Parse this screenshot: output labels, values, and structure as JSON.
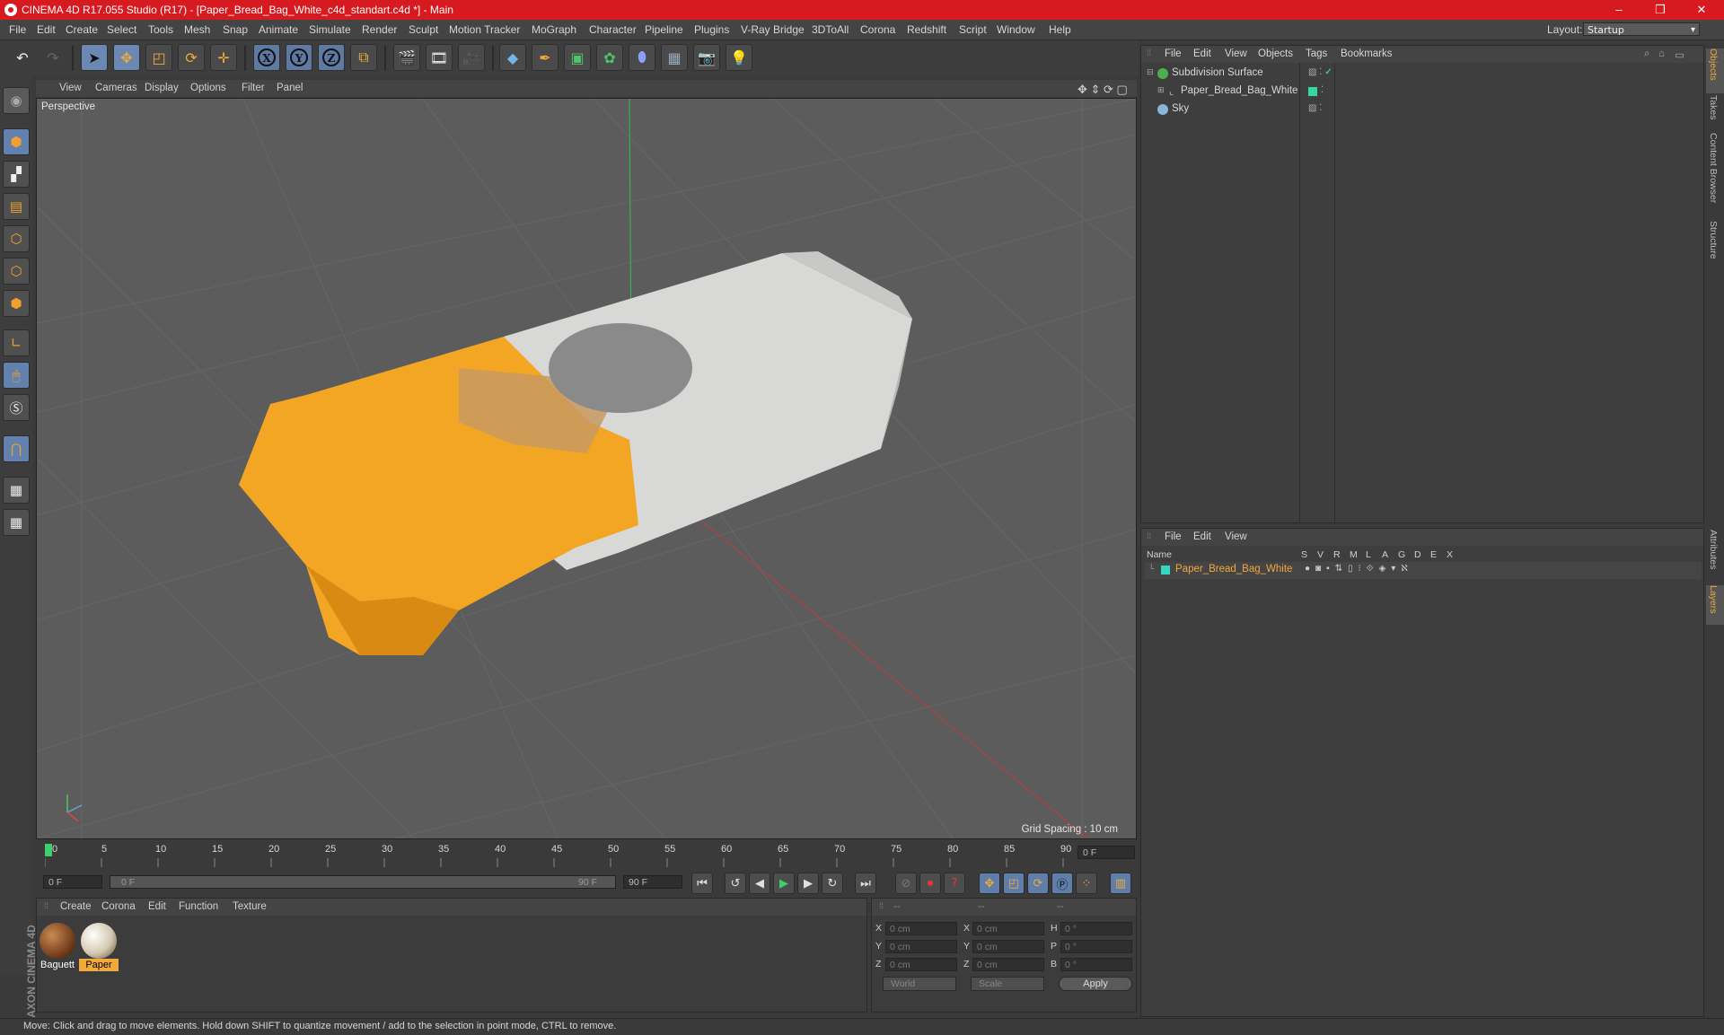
{
  "window": {
    "title": "CINEMA 4D R17.055 Studio (R17) - [Paper_Bread_Bag_White_c4d_standart.c4d *] - Main",
    "minimize": "–",
    "maximize": "❐",
    "close": "✕"
  },
  "menubar": {
    "items": [
      "File",
      "Edit",
      "Create",
      "Select",
      "Tools",
      "Mesh",
      "Snap",
      "Animate",
      "Simulate",
      "Render",
      "Sculpt",
      "Motion Tracker",
      "MoGraph",
      "Character",
      "Pipeline",
      "Plugins",
      "V-Ray Bridge",
      "3DToAll",
      "Corona",
      "Redshift",
      "Script",
      "Window",
      "Help"
    ],
    "layout_label": "Layout:",
    "layout_value": "Startup"
  },
  "toolbar": {
    "axis_x": "X",
    "axis_y": "Y",
    "axis_z": "Z"
  },
  "viewport": {
    "menu": [
      "View",
      "Cameras",
      "Display",
      "Options",
      "Filter",
      "Panel"
    ],
    "camera_label": "Perspective",
    "grid_spacing": "Grid Spacing : 10 cm"
  },
  "timeline": {
    "ticks": [
      "0",
      "5",
      "10",
      "15",
      "20",
      "25",
      "30",
      "35",
      "40",
      "45",
      "50",
      "55",
      "60",
      "65",
      "70",
      "75",
      "80",
      "85",
      "90"
    ],
    "current_frame": "0 F",
    "start_frame": "0 F",
    "range_start": "0 F",
    "range_end": "90 F",
    "end_frame": "90 F"
  },
  "materials": {
    "menu": [
      "Create",
      "Corona",
      "Edit",
      "Function",
      "Texture"
    ],
    "items": [
      {
        "name": "Baguett",
        "selected": false
      },
      {
        "name": "Paper",
        "selected": true
      }
    ]
  },
  "coordinates": {
    "header": [
      "--",
      "--",
      "--"
    ],
    "rows": [
      {
        "a": "X",
        "v1": "0 cm",
        "b": "X",
        "v2": "0 cm",
        "c": "H",
        "v3": "0 °"
      },
      {
        "a": "Y",
        "v1": "0 cm",
        "b": "Y",
        "v2": "0 cm",
        "c": "P",
        "v3": "0 °"
      },
      {
        "a": "Z",
        "v1": "0 cm",
        "b": "Z",
        "v2": "0 cm",
        "c": "B",
        "v3": "0 °"
      }
    ],
    "space": "World",
    "mode": "Scale",
    "apply": "Apply"
  },
  "objects": {
    "menu": [
      "File",
      "Edit",
      "View",
      "Objects",
      "Tags",
      "Bookmarks"
    ],
    "items": [
      {
        "name": "Subdivision Surface",
        "color": "#4caf50"
      },
      {
        "name": "Paper_Bread_Bag_White",
        "color": "#5bc0de"
      },
      {
        "name": "Sky",
        "color": "#8ab4d8"
      }
    ]
  },
  "layers": {
    "menu": [
      "File",
      "Edit",
      "View"
    ],
    "columns": [
      "Name",
      "S",
      "V",
      "R",
      "M",
      "L",
      "A",
      "G",
      "D",
      "E",
      "X"
    ],
    "items": [
      {
        "name": "Paper_Bread_Bag_White",
        "color": "#34d8c0"
      }
    ]
  },
  "sidetabs": [
    "Objects",
    "Takes",
    "Content Browser",
    "Structure",
    "Attributes",
    "Layers"
  ],
  "status": "Move: Click and drag to move elements. Hold down SHIFT to quantize movement / add to the selection in point mode, CTRL to remove.",
  "brand": "MAXON CINEMA 4D",
  "colors": {
    "accent": "#f2a93b",
    "title_bar": "#d71920",
    "selection": "#6282ad"
  }
}
